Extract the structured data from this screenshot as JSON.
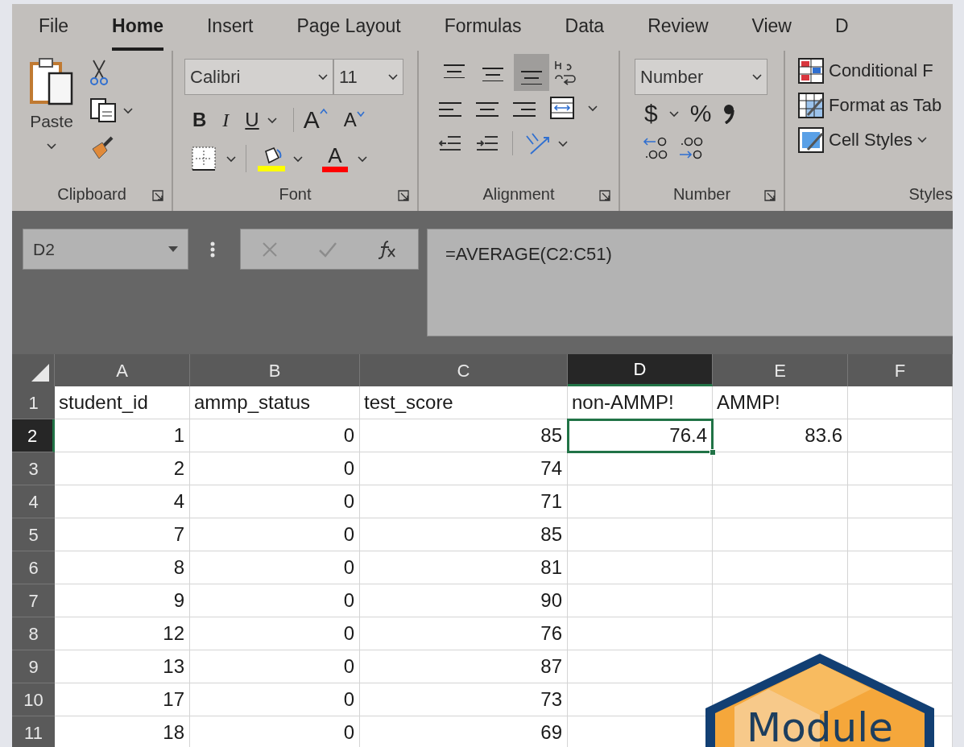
{
  "tabs": [
    {
      "label": "File",
      "selected": false
    },
    {
      "label": "Home",
      "selected": true
    },
    {
      "label": "Insert",
      "selected": false
    },
    {
      "label": "Page Layout",
      "selected": false
    },
    {
      "label": "Formulas",
      "selected": false
    },
    {
      "label": "Data",
      "selected": false
    },
    {
      "label": "Review",
      "selected": false
    },
    {
      "label": "View",
      "selected": false
    },
    {
      "label": "D",
      "selected": false
    }
  ],
  "clipboard": {
    "paste": "Paste",
    "label": "Clipboard"
  },
  "font": {
    "name": "Calibri",
    "size": "11",
    "bold": "B",
    "italic": "I",
    "underline": "U",
    "grow": "A",
    "shrink": "A",
    "font_color_letter": "A",
    "label": "Font"
  },
  "alignment": {
    "vertical": [
      {
        "selected": false
      },
      {
        "selected": false
      },
      {
        "selected": true
      }
    ],
    "label": "Alignment"
  },
  "number": {
    "format": "Number",
    "currency": "$",
    "percent": "%",
    "label": "Number"
  },
  "styles": {
    "items": [
      "Conditional F",
      "Format as Tab",
      "Cell Styles"
    ],
    "label": "Styles"
  },
  "formula_bar": {
    "name_box": "D2",
    "formula": "=AVERAGE(C2:C51)"
  },
  "columns": [
    {
      "label": "A",
      "selected": false
    },
    {
      "label": "B",
      "selected": false
    },
    {
      "label": "C",
      "selected": false
    },
    {
      "label": "D",
      "selected": true
    },
    {
      "label": "E",
      "selected": false
    },
    {
      "label": "F",
      "selected": false
    }
  ],
  "rows": [
    {
      "number": "1",
      "selected": false,
      "kind": "text",
      "cells": [
        {
          "value": "student_id",
          "active": false
        },
        {
          "value": "ammp_status",
          "active": false
        },
        {
          "value": "test_score",
          "active": false
        },
        {
          "value": "non-AMMP!",
          "active": false
        },
        {
          "value": "AMMP!",
          "active": false
        }
      ]
    },
    {
      "number": "2",
      "selected": true,
      "kind": "number",
      "cells": [
        {
          "value": "1",
          "active": false
        },
        {
          "value": "0",
          "active": false
        },
        {
          "value": "85",
          "active": false
        },
        {
          "value": "76.4",
          "active": true
        },
        {
          "value": "83.6",
          "active": false
        }
      ]
    },
    {
      "number": "3",
      "selected": false,
      "kind": "number",
      "cells": [
        {
          "value": "2",
          "active": false
        },
        {
          "value": "0",
          "active": false
        },
        {
          "value": "74",
          "active": false
        }
      ]
    },
    {
      "number": "4",
      "selected": false,
      "kind": "number",
      "cells": [
        {
          "value": "4",
          "active": false
        },
        {
          "value": "0",
          "active": false
        },
        {
          "value": "71",
          "active": false
        }
      ]
    },
    {
      "number": "5",
      "selected": false,
      "kind": "number",
      "cells": [
        {
          "value": "7",
          "active": false
        },
        {
          "value": "0",
          "active": false
        },
        {
          "value": "85",
          "active": false
        }
      ]
    },
    {
      "number": "6",
      "selected": false,
      "kind": "number",
      "cells": [
        {
          "value": "8",
          "active": false
        },
        {
          "value": "0",
          "active": false
        },
        {
          "value": "81",
          "active": false
        }
      ]
    },
    {
      "number": "7",
      "selected": false,
      "kind": "number",
      "cells": [
        {
          "value": "9",
          "active": false
        },
        {
          "value": "0",
          "active": false
        },
        {
          "value": "90",
          "active": false
        }
      ]
    },
    {
      "number": "8",
      "selected": false,
      "kind": "number",
      "cells": [
        {
          "value": "12",
          "active": false
        },
        {
          "value": "0",
          "active": false
        },
        {
          "value": "76",
          "active": false
        }
      ]
    },
    {
      "number": "9",
      "selected": false,
      "kind": "number",
      "cells": [
        {
          "value": "13",
          "active": false
        },
        {
          "value": "0",
          "active": false
        },
        {
          "value": "87",
          "active": false
        }
      ]
    },
    {
      "number": "10",
      "selected": false,
      "kind": "number",
      "cells": [
        {
          "value": "17",
          "active": false
        },
        {
          "value": "0",
          "active": false
        },
        {
          "value": "73",
          "active": false
        }
      ]
    },
    {
      "number": "11",
      "selected": false,
      "kind": "number",
      "cells": [
        {
          "value": "18",
          "active": false
        },
        {
          "value": "0",
          "active": false
        },
        {
          "value": "69",
          "active": false
        }
      ]
    }
  ],
  "logo": {
    "text": "Module"
  }
}
